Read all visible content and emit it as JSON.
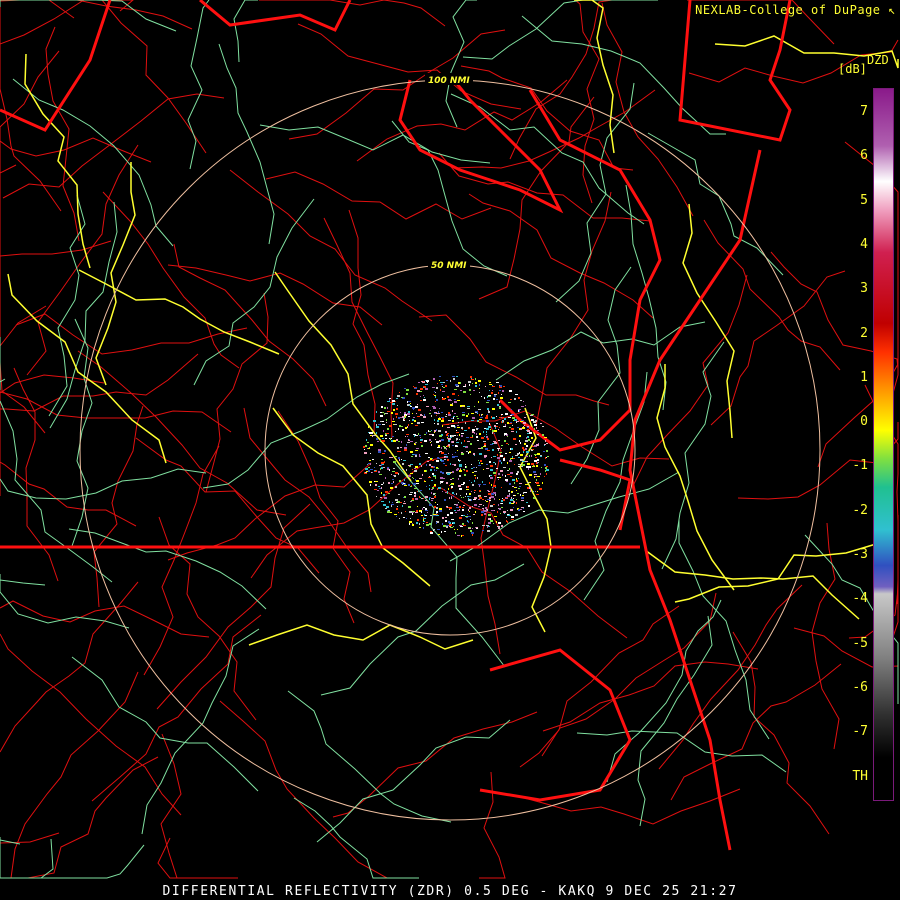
{
  "credit": "NEXLAB-College of DuPage",
  "credit_icon": "k-logo-icon",
  "legend": {
    "product": "DZD",
    "unit": "[dB]",
    "ticks": [
      "7",
      "6",
      "5",
      "4",
      "3",
      "2",
      "1",
      "0",
      "-1",
      "-2",
      "-3",
      "-4",
      "-5",
      "-6",
      "-7",
      "TH"
    ],
    "colors": [
      "#8a1a8a",
      "#b060b0",
      "#ffffff",
      "#f0a0c0",
      "#d02050",
      "#c00000",
      "#ff3000",
      "#ff9000",
      "#ffff00",
      "#80e040",
      "#20c090",
      "#30c0d0",
      "#3050c0",
      "#7060c0",
      "#c8c8c8",
      "#808080",
      "#303030",
      "#000000"
    ]
  },
  "range_rings": [
    "100 NMI",
    "50 NMI"
  ],
  "footer": "DIFFERENTIAL REFLECTIVITY (ZDR) 0.5 DEG - KAKQ 9 DEC 25 21:27",
  "map_colors": {
    "state": "#ff1010",
    "county": "#e01010",
    "road_major": "#ffff30",
    "road_minor": "#80e0a0",
    "ring": "#f0c0a0"
  }
}
